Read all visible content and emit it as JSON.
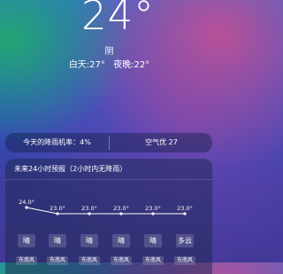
{
  "current": {
    "temperature": "24°",
    "condition": "阴",
    "day_temp": "白天:27°",
    "night_temp": "夜晚:22°"
  },
  "stats": {
    "rain_probability": "今天的降雨机率：4%",
    "air_quality": "空气优 27"
  },
  "forecast": {
    "title": "未来24小时预报（2小时内无降雨）",
    "temp_labels": [
      "24.0°",
      "23.0°",
      "23.0°",
      "23.0°",
      "23.0°",
      "23.0°"
    ],
    "conditions": [
      "晴",
      "晴",
      "晴",
      "晴",
      "晴",
      "多云"
    ],
    "winds": [
      "东南风",
      "东南风",
      "东南风",
      "东南风",
      "东南风",
      "东南风"
    ]
  },
  "chart_data": {
    "type": "line",
    "x": [
      "1",
      "2",
      "3",
      "4",
      "5",
      "6"
    ],
    "series": [
      {
        "values": [
          24.0,
          23.0,
          23.0,
          23.0,
          23.0,
          23.0
        ]
      }
    ],
    "title": "",
    "xlabel": "",
    "ylabel": ""
  }
}
